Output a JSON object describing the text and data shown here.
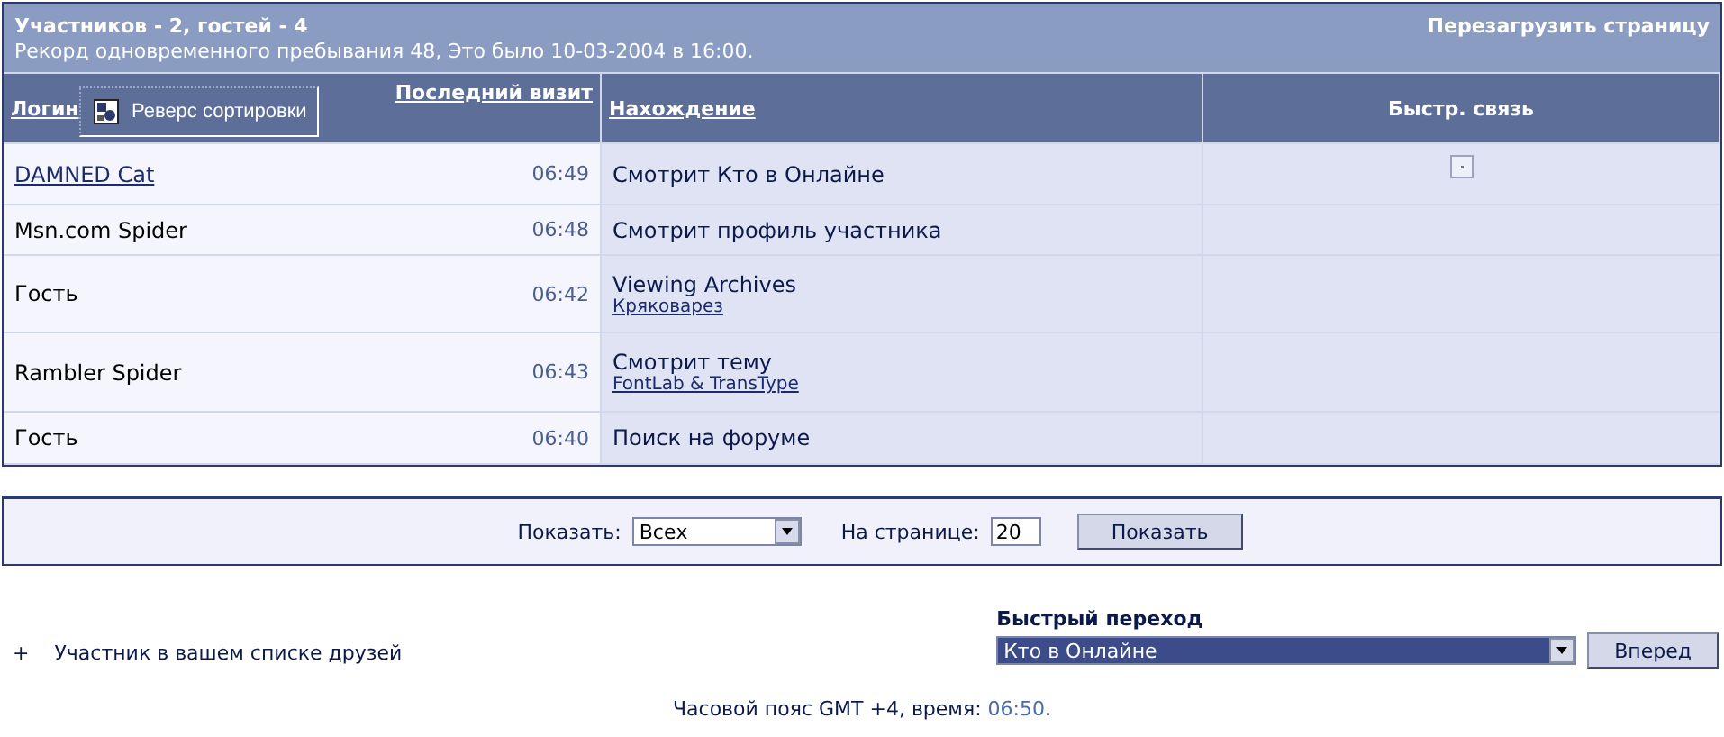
{
  "header": {
    "title": "Участников - 2, гостей - 4",
    "record": "Рекорд одновременного пребывания 48, Это было 10-03-2004 в 16:00.",
    "reload": "Перезагрузить страницу"
  },
  "columns": {
    "login": "Логин",
    "last_visit": "Последний визит",
    "location": "Нахождение",
    "quick": "Быстр. связь"
  },
  "tooltip": {
    "text": "Реверс сортировки"
  },
  "rows": [
    {
      "name": "DAMNED Cat",
      "link": true,
      "time": "06:49",
      "location": "Смотрит Кто в Онлайне",
      "contact_icon": true
    },
    {
      "name": "Msn.com Spider",
      "link": false,
      "time": "06:48",
      "location": "Смотрит профиль участника",
      "contact_icon": false
    },
    {
      "name": "Гость",
      "link": false,
      "time": "06:42",
      "location": "Viewing Archives",
      "location_link": "Кряковарез",
      "contact_icon": false
    },
    {
      "name": "Rambler Spider",
      "link": false,
      "time": "06:43",
      "location": "Смотрит тему",
      "location_link": "FontLab & TransType",
      "contact_icon": false
    },
    {
      "name": "Гость",
      "link": false,
      "time": "06:40",
      "location": "Поиск на форуме",
      "contact_icon": false
    }
  ],
  "filter": {
    "show_label": "Показать:",
    "show_value": "Всех",
    "per_page_label": "На странице:",
    "per_page_value": "20",
    "button": "Показать"
  },
  "legend": {
    "mark": "+",
    "text": "Участник в вашем списке друзей"
  },
  "jump": {
    "label": "Быстрый переход",
    "value": "Кто в Онлайне",
    "button": "Вперед"
  },
  "footer": {
    "text": "Часовой пояс GMT +4, время:",
    "time": "06:50",
    "end": "."
  }
}
